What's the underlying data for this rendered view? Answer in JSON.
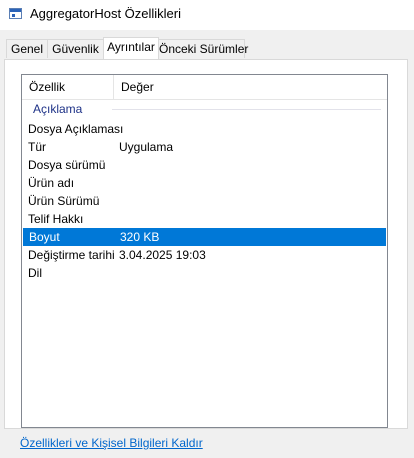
{
  "window": {
    "title": "AggregatorHost Özellikleri"
  },
  "tabs": [
    {
      "label": "Genel",
      "active": false
    },
    {
      "label": "Güvenlik",
      "active": false
    },
    {
      "label": "Ayrıntılar",
      "active": true
    },
    {
      "label": "Önceki Sürümler",
      "active": false
    }
  ],
  "details": {
    "columns": {
      "property": "Özellik",
      "value": "Değer"
    },
    "group": "Açıklama",
    "rows": [
      {
        "key": "Dosya Açıklaması",
        "value": ""
      },
      {
        "key": "Tür",
        "value": "Uygulama"
      },
      {
        "key": "Dosya sürümü",
        "value": ""
      },
      {
        "key": "Ürün adı",
        "value": ""
      },
      {
        "key": "Ürün Sürümü",
        "value": ""
      },
      {
        "key": "Telif Hakkı",
        "value": ""
      },
      {
        "key": "Boyut",
        "value": "320 KB",
        "selected": true
      },
      {
        "key": "Değiştirme tarihi",
        "value": "3.04.2025 19:03"
      },
      {
        "key": "Dil",
        "value": ""
      }
    ]
  },
  "footer": {
    "remove_link": "Özellikleri ve Kişisel Bilgileri Kaldır"
  },
  "colors": {
    "selection": "#0078d7",
    "group_header": "#1e3287",
    "link": "#0066cc"
  }
}
